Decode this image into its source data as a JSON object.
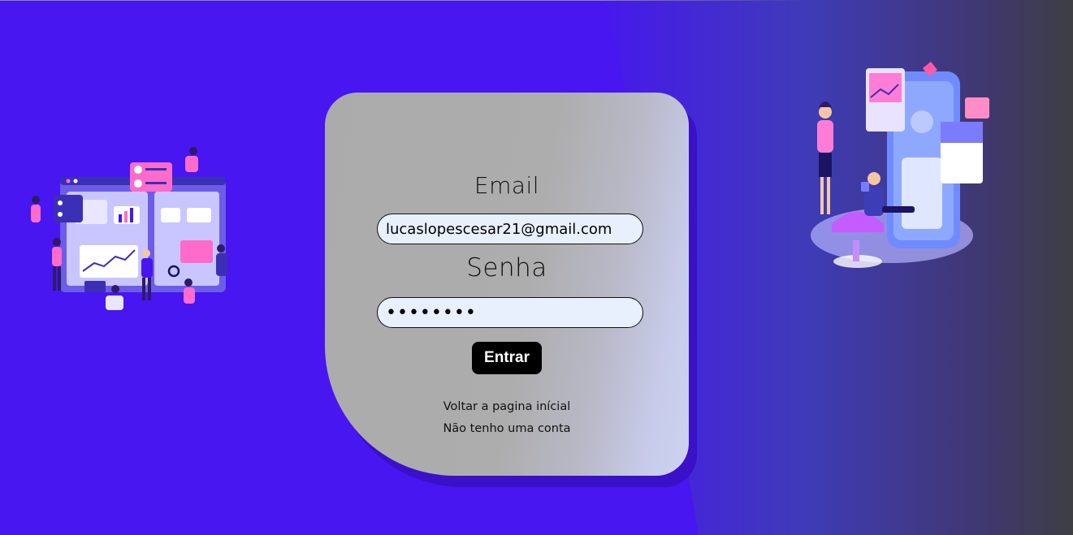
{
  "login": {
    "email_label": "Email",
    "email_value": "lucaslopescesar21@gmail.com",
    "password_label": "Senha",
    "password_value": "••••••••",
    "submit_label": "Entrar",
    "home_link": "Voltar a pagina inícial",
    "signup_link": "Não tenho uma conta"
  },
  "colors": {
    "background": "#4716f0",
    "card": "#ababab",
    "button": "#000000"
  },
  "illustrations": {
    "left": "team-dashboard-illustration",
    "right": "mobile-app-team-illustration"
  }
}
